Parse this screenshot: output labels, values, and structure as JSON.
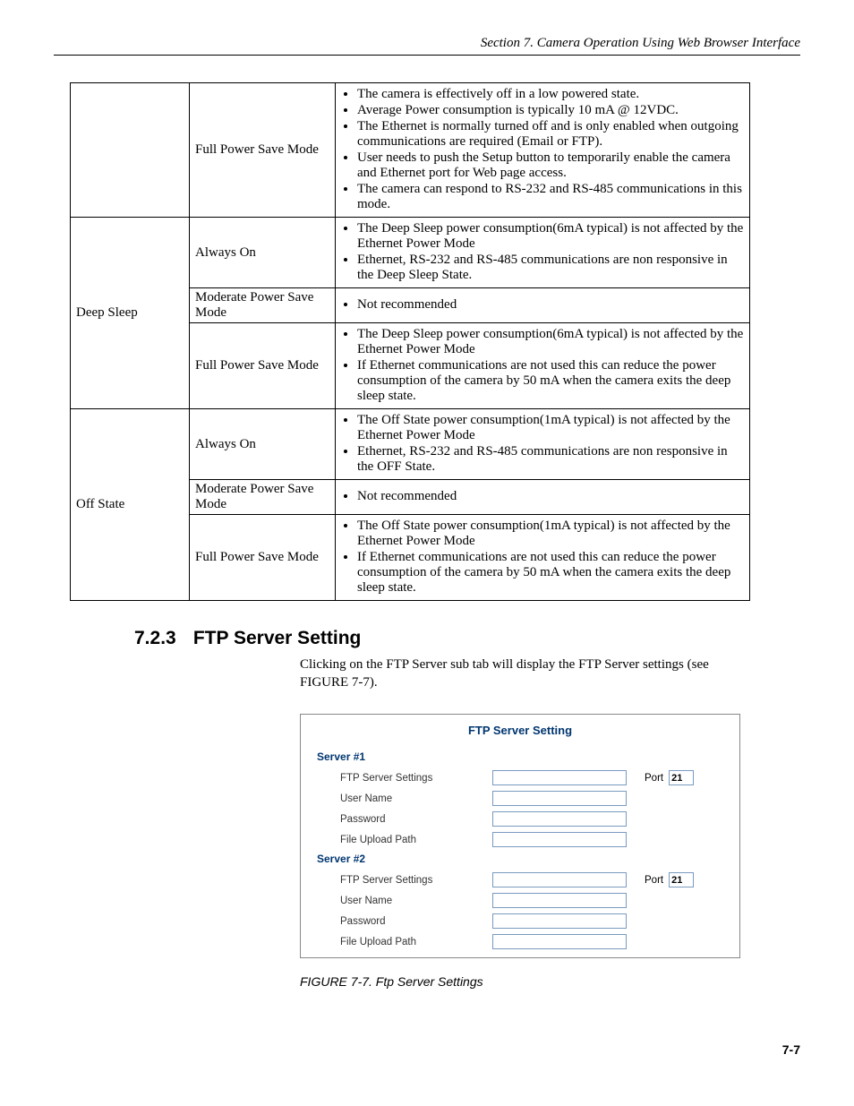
{
  "header": "Section 7.  Camera Operation Using Web Browser Interface",
  "table_rows": [
    {
      "col1": "",
      "col2": "Full Power Save Mode",
      "items": [
        "The camera is effectively off in a low powered state.",
        "Average Power consumption is typically 10 mA @ 12VDC.",
        "The Ethernet is normally turned off and is only enabled when outgoing communications are required (Email or FTP).",
        "User needs to push the Setup button to temporarily enable the camera and Ethernet port for Web page access.",
        "The camera can respond to RS-232 and RS-485 communications in this mode."
      ],
      "col1_rowspan": 1
    },
    {
      "col1": "Deep Sleep",
      "col2": "Always On",
      "items": [
        "The Deep Sleep power consumption(6mA typical) is not affected by the Ethernet Power Mode",
        "Ethernet, RS-232 and RS-485 communications are non responsive in the Deep Sleep State."
      ],
      "col1_rowspan": 3
    },
    {
      "col1": "",
      "col2": "Moderate Power Save Mode",
      "items": [
        "Not recommended"
      ]
    },
    {
      "col1": "",
      "col2": "Full Power Save Mode",
      "items": [
        "The Deep Sleep power consumption(6mA typical) is not affected by the Ethernet Power Mode",
        "If Ethernet communications are not used this can reduce the power consumption of the camera by 50 mA when the camera exits the deep sleep state."
      ]
    },
    {
      "col1": "Off State",
      "col2": "Always On",
      "items": [
        "The Off State power consumption(1mA typical) is not affected by the Ethernet Power Mode",
        "Ethernet, RS-232 and RS-485 communications are non responsive in the OFF State."
      ],
      "col1_rowspan": 3
    },
    {
      "col1": "",
      "col2": "Moderate Power Save Mode",
      "items": [
        "Not recommended"
      ]
    },
    {
      "col1": "",
      "col2": "Full Power Save Mode",
      "items": [
        "The Off State power consumption(1mA typical) is not affected by the Ethernet Power Mode",
        "If Ethernet communications are not used this can reduce the power consumption of the camera by 50 mA when the camera exits the deep sleep state."
      ]
    }
  ],
  "section_num": "7.2.3",
  "section_title": "FTP Server Setting",
  "intro": "Clicking on the FTP Server sub tab will display the FTP Server settings (see FIGURE 7-7).",
  "ftp": {
    "title": "FTP Server Setting",
    "servers": [
      {
        "label": "Server #1",
        "fields": {
          "settings_label": "FTP Server Settings",
          "settings_value": "",
          "port_label": "Port",
          "port_value": "21",
          "user_label": "User Name",
          "user_value": "",
          "pass_label": "Password",
          "pass_value": "",
          "path_label": "File Upload Path",
          "path_value": ""
        }
      },
      {
        "label": "Server #2",
        "fields": {
          "settings_label": "FTP Server Settings",
          "settings_value": "",
          "port_label": "Port",
          "port_value": "21",
          "user_label": "User Name",
          "user_value": "",
          "pass_label": "Password",
          "pass_value": "",
          "path_label": "File Upload Path",
          "path_value": ""
        }
      }
    ]
  },
  "figure_caption": "FIGURE 7-7.  Ftp Server Settings",
  "page_num": "7-7"
}
